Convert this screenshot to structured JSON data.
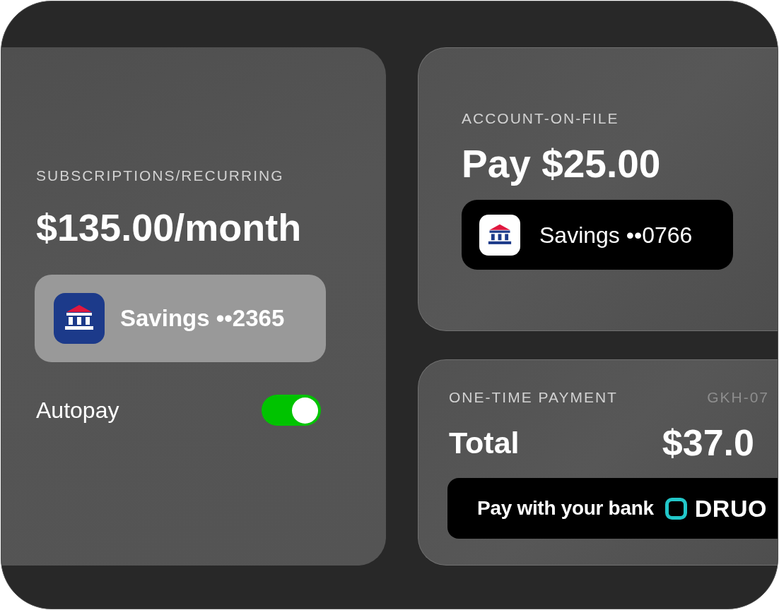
{
  "subscription_card": {
    "label": "SUBSCRIPTIONS/RECURRING",
    "amount": "$135.00/month",
    "account": {
      "kind": "light",
      "text": "Savings ••2365"
    },
    "autopay": {
      "label": "Autopay",
      "on": true
    }
  },
  "account_on_file_card": {
    "label": "ACCOUNT-ON-FILE",
    "title": "Pay $25.00",
    "account": {
      "kind": "dark",
      "text": "Savings ••0766"
    }
  },
  "one_time_payment_card": {
    "label": "ONE-TIME PAYMENT",
    "reference": "GKH-07",
    "total_label": "Total",
    "total_amount": "$37.0",
    "pay_button": {
      "text": "Pay with your bank",
      "logo": "DRUO"
    }
  }
}
